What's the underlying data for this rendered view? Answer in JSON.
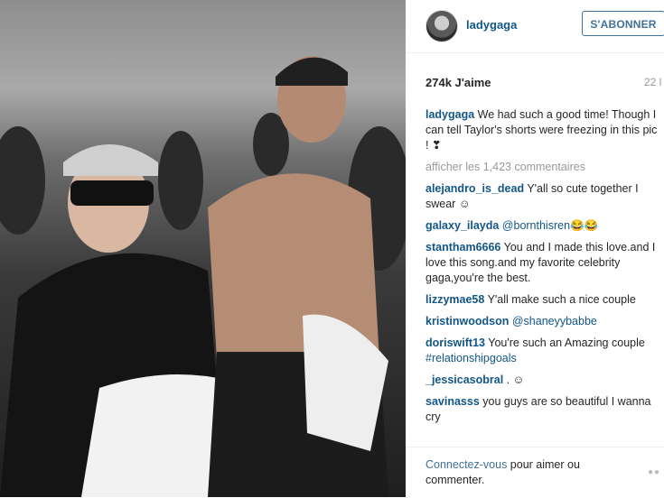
{
  "header": {
    "username": "ladygaga",
    "follow_label": "S'ABONNER"
  },
  "stats": {
    "likes": "274k J'aime",
    "time": "22 l"
  },
  "caption": {
    "user": "ladygaga",
    "text": "We had such a good time! Though I can tell Taylor's shorts were freezing in this pic ! ❣"
  },
  "more_comments": "afficher les 1,423 commentaires",
  "comments": [
    {
      "user": "alejandro_is_dead",
      "text": "Y'all so cute together I swear ☺",
      "mention": ""
    },
    {
      "user": "galaxy_ilayda",
      "text": "😂😂",
      "mention": "@bornthisren"
    },
    {
      "user": "stantham6666",
      "text": "You and I made this love.and I love this song.and my favorite celebrity gaga,you're the best.",
      "mention": ""
    },
    {
      "user": "lizzymae58",
      "text": "Y'all make such a nice couple",
      "mention": ""
    },
    {
      "user": "kristinwoodson",
      "text": "",
      "mention": "@shaneyybabbe"
    },
    {
      "user": "doriswift13",
      "text": "You're such an Amazing couple",
      "mention": "#relationshipgoals"
    },
    {
      "user": "_jessicasobral",
      "text": ". ☺",
      "mention": ""
    },
    {
      "user": "savinasss",
      "text": "you guys are so beautiful I wanna cry",
      "mention": ""
    }
  ],
  "footer": {
    "login_link": "Connectez-vous",
    "login_text": " pour aimer ou commenter."
  },
  "icons": {
    "options": "more-options-icon"
  },
  "colors": {
    "link": "#125688",
    "button": "#3f729b",
    "muted": "#999999"
  }
}
